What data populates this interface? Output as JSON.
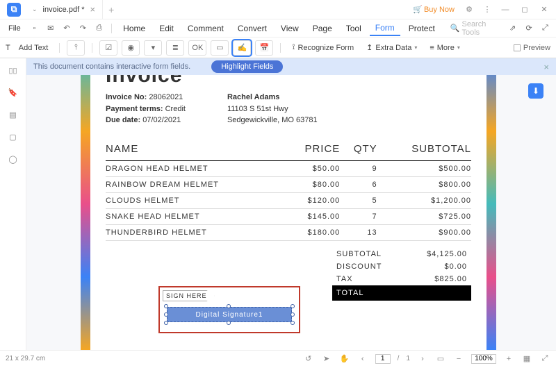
{
  "titlebar": {
    "tab_name": "invoice.pdf *",
    "buynow": "Buy Now"
  },
  "menubar": {
    "file": "File",
    "tabs": [
      "Home",
      "Edit",
      "Comment",
      "Convert",
      "View",
      "Page",
      "Tool",
      "Form",
      "Protect"
    ],
    "active_index": 7,
    "search_placeholder": "Search Tools"
  },
  "toolbar": {
    "addtext": "Add Text",
    "recognize": "Recognize Form",
    "extra": "Extra Data",
    "more": "More",
    "preview": "Preview"
  },
  "banner": {
    "msg": "This document contains interactive form fields.",
    "btn": "Highlight Fields"
  },
  "invoice": {
    "title": "Invoice",
    "fields": {
      "inv_label": "Invoice No:",
      "inv_val": "28062021",
      "pay_label": "Payment terms:",
      "pay_val": "Credit",
      "due_label": "Due date:",
      "due_val": "07/02/2021"
    },
    "ship": {
      "name": "Rachel Adams",
      "addr1": "11103 S 51st Hwy",
      "addr2": "Sedgewickville, MO 63781"
    },
    "headers": [
      "NAME",
      "PRICE",
      "QTY",
      "SUBTOTAL"
    ],
    "rows": [
      {
        "n": "DRAGON HEAD HELMET",
        "p": "$50.00",
        "q": "9",
        "s": "$500.00"
      },
      {
        "n": "RAINBOW DREAM HELMET",
        "p": "$80.00",
        "q": "6",
        "s": "$800.00"
      },
      {
        "n": "CLOUDS HELMET",
        "p": "$120.00",
        "q": "5",
        "s": "$1,200.00"
      },
      {
        "n": "SNAKE HEAD HELMET",
        "p": "$145.00",
        "q": "7",
        "s": "$725.00"
      },
      {
        "n": "THUNDERBIRD HELMET",
        "p": "$180.00",
        "q": "13",
        "s": "$900.00"
      }
    ],
    "totals": {
      "sub_l": "SUBTOTAL",
      "sub_v": "$4,125.00",
      "disc_l": "DISCOUNT",
      "disc_v": "$0.00",
      "tax_l": "TAX",
      "tax_v": "$825.00",
      "tot_l": "TOTAL"
    },
    "sign_here": "SIGN HERE",
    "sig_field": "Digital Signature1"
  },
  "statusbar": {
    "dims": "21 x 29.7 cm",
    "page_cur": "1",
    "page_sep": "/",
    "page_tot": "1",
    "zoom": "100%"
  }
}
